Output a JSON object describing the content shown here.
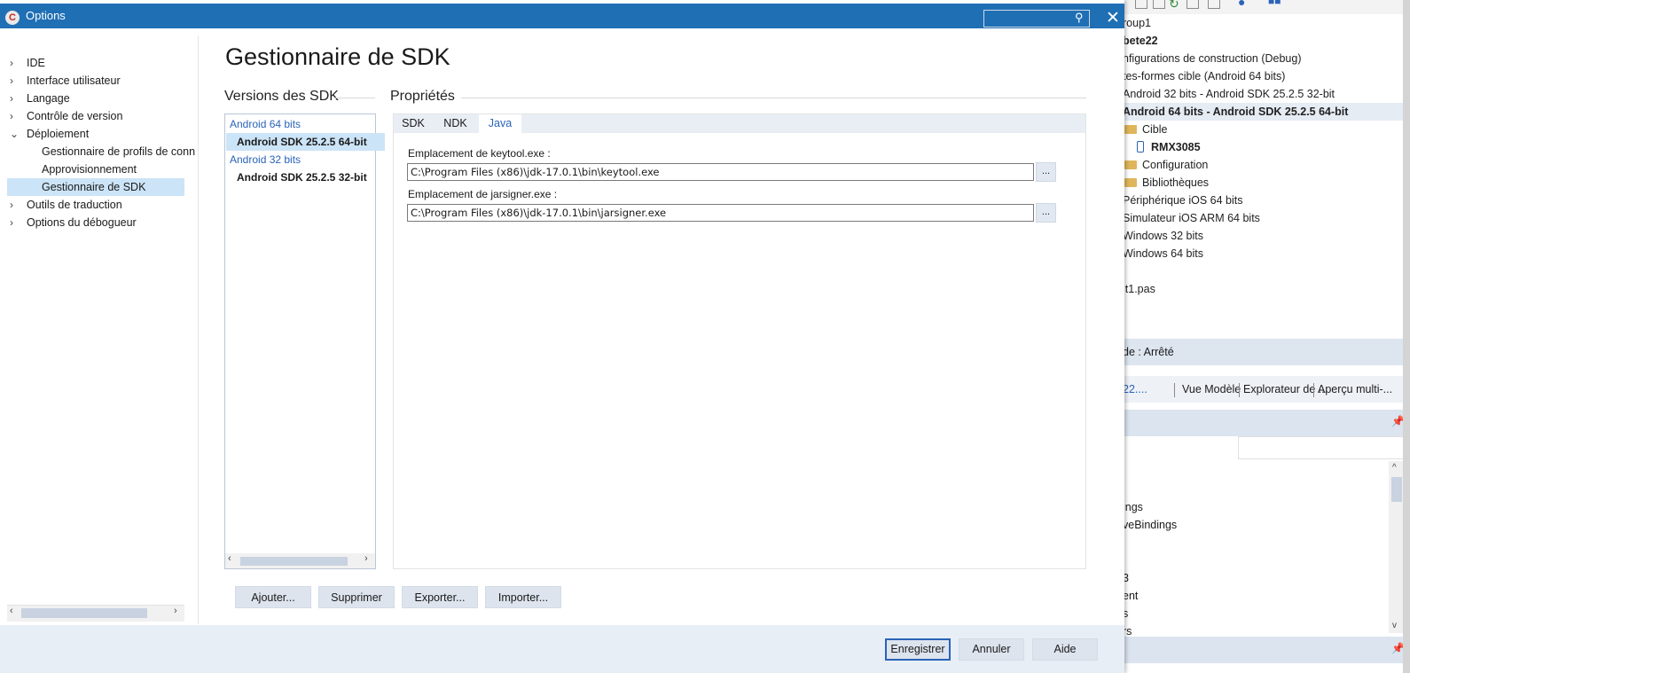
{
  "window": {
    "title": "Options",
    "search_placeholder": ""
  },
  "tree": {
    "items": [
      {
        "label": "IDE",
        "chevron": "›"
      },
      {
        "label": "Interface utilisateur",
        "chevron": "›"
      },
      {
        "label": "Langage",
        "chevron": "›"
      },
      {
        "label": "Contrôle de version",
        "chevron": "›"
      },
      {
        "label": "Déploiement",
        "chevron": "⌄"
      },
      {
        "label": "Gestionnaire de profils de conn",
        "chevron": ""
      },
      {
        "label": "Approvisionnement",
        "chevron": ""
      },
      {
        "label": "Gestionnaire de SDK",
        "chevron": ""
      },
      {
        "label": "Outils de traduction",
        "chevron": "›"
      },
      {
        "label": "Options du débogueur",
        "chevron": "›"
      }
    ],
    "selected": "Gestionnaire de SDK"
  },
  "page": {
    "title": "Gestionnaire de SDK",
    "versions_title": "Versions des SDK",
    "properties_title": "Propriétés"
  },
  "versions": [
    {
      "kind": "group",
      "label": "Android 64 bits"
    },
    {
      "kind": "sdk",
      "label": "Android SDK 25.2.5 64-bit",
      "selected": true
    },
    {
      "kind": "group",
      "label": "Android 32 bits"
    },
    {
      "kind": "sdk",
      "label": "Android SDK 25.2.5 32-bit"
    }
  ],
  "tabs": [
    {
      "label": "SDK",
      "active": false
    },
    {
      "label": "NDK",
      "active": false
    },
    {
      "label": "Java",
      "active": true
    }
  ],
  "java": {
    "keytool_label": "Emplacement de keytool.exe :",
    "keytool_value": "C:\\Program Files (x86)\\jdk-17.0.1\\bin\\keytool.exe",
    "jarsigner_label": "Emplacement de jarsigner.exe :",
    "jarsigner_value": "C:\\Program Files (x86)\\jdk-17.0.1\\bin\\jarsigner.exe",
    "browse_label": "..."
  },
  "actions": {
    "add": "Ajouter...",
    "remove": "Supprimer",
    "export": "Exporter...",
    "import": "Importer..."
  },
  "footer": {
    "save": "Enregistrer",
    "cancel": "Annuler",
    "help": "Aide"
  },
  "ide_background": {
    "project_rows": [
      {
        "label": "roup1",
        "style": "normal"
      },
      {
        "label": "bete22",
        "style": "bold"
      },
      {
        "label": "nfigurations de construction (Debug)",
        "style": "normal"
      },
      {
        "label": "tes-formes cible (Android 64 bits)",
        "style": "normal"
      },
      {
        "label": "Android 32 bits - Android SDK 25.2.5 32-bit",
        "style": "normal"
      },
      {
        "label": "Android 64 bits - Android SDK 25.2.5 64-bit",
        "style": "bold-selected"
      },
      {
        "label": "Cible",
        "style": "folder"
      },
      {
        "label": "RMX3085",
        "style": "device"
      },
      {
        "label": "Configuration",
        "style": "folder"
      },
      {
        "label": "Bibliothèques",
        "style": "folder"
      },
      {
        "label": "Périphérique iOS 64 bits",
        "style": "normal"
      },
      {
        "label": "Simulateur iOS ARM 64 bits",
        "style": "normal"
      },
      {
        "label": "Windows 32 bits",
        "style": "normal"
      },
      {
        "label": "Windows 64 bits",
        "style": "normal"
      },
      {
        "label": "it1.pas",
        "style": "normal"
      }
    ],
    "status": "de : Arrêté",
    "tabs": [
      "22....",
      "Vue Modèle",
      "Explorateur de ...",
      "Aperçu multi-..."
    ],
    "list_fragments": [
      "ings",
      "veBindings",
      "3",
      "ent",
      "s",
      "rs"
    ]
  }
}
